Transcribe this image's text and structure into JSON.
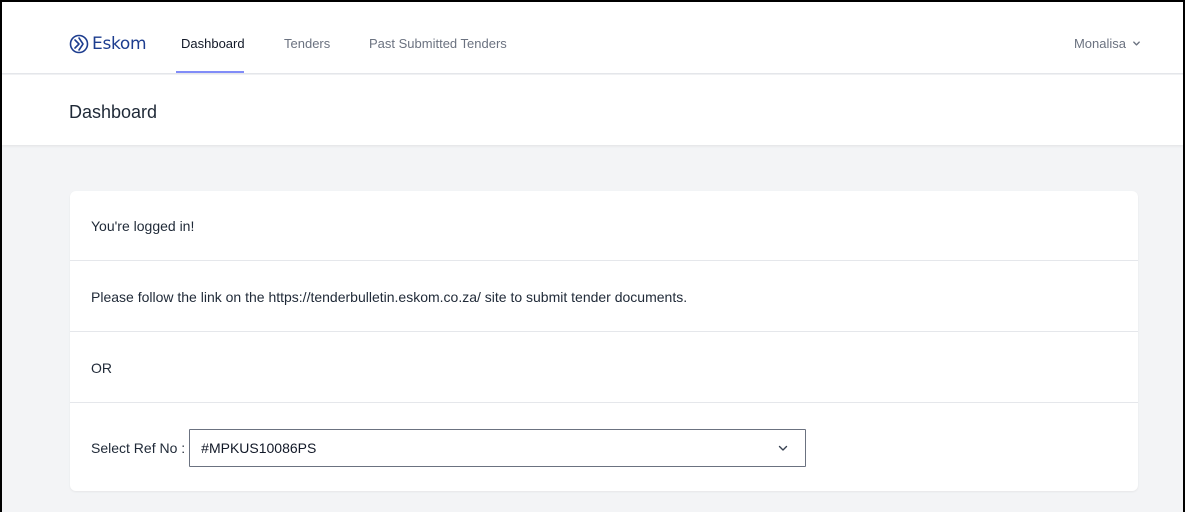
{
  "nav": {
    "logo_text": "Eskom",
    "links": [
      {
        "label": "Dashboard",
        "active": true
      },
      {
        "label": "Tenders",
        "active": false
      },
      {
        "label": "Past Submitted Tenders",
        "active": false
      }
    ],
    "user_name": "Monalisa",
    "user_menu_icon": "chevron-down-icon",
    "active_underline_color": "#818cf8"
  },
  "header": {
    "title": "Dashboard"
  },
  "card": {
    "logged_in_message": "You're logged in!",
    "instruction": "Please follow the link on the https://tenderbulletin.eskom.co.za/ site to submit tender documents.",
    "or_label": "OR",
    "select": {
      "label": "Select Ref No :",
      "value": "#MPKUS10086PS",
      "icon": "chevron-down-icon"
    }
  },
  "colors": {
    "brand": "#1d3d8f",
    "page_background": "#f3f4f6",
    "border": "#e5e7eb"
  }
}
